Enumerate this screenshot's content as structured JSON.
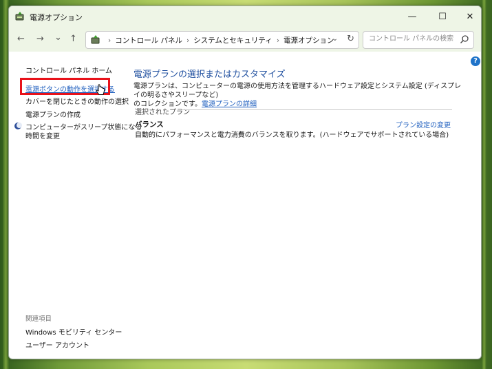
{
  "window": {
    "title": "電源オプション",
    "minimize": "—",
    "maximize": "☐",
    "close": "✕"
  },
  "nav": {
    "back": "←",
    "forward": "→",
    "recent": "⌄",
    "up": "↑",
    "breadcrumbs": [
      "コントロール パネル",
      "システムとセキュリティ",
      "電源オプション"
    ],
    "refresh": "↻",
    "search_placeholder": "コントロール パネルの検索"
  },
  "sidebar": {
    "home": "コントロール パネル ホーム",
    "items": [
      "電源ボタンの動作を選択する",
      "カバーを閉じたときの動作の選択",
      "電源プランの作成",
      "コンピューターがスリープ状態になる",
      "時間を変更"
    ],
    "related_heading": "関連項目",
    "related": [
      "Windows モビリティ センター",
      "ユーザー アカウント"
    ]
  },
  "main": {
    "heading": "電源プランの選択またはカスタマイズ",
    "description_line1": "電源プランは、コンピューターの電源の使用方法を管理するハードウェア設定とシステム設定 (ディスプレイの明るさやスリープなど)",
    "description_line2": "のコレクションです。",
    "description_link": "電源プランの詳細",
    "selected_plan_label": "選択されたプラン",
    "plan_name": "バランス",
    "plan_description": "自動的にパフォーマンスと電力消費のバランスを取ります。(ハードウェアでサポートされている場合)",
    "plan_change_link": "プラン設定の変更"
  },
  "help_glyph": "?",
  "colors": {
    "highlight": "#e8121a",
    "link": "#1f5fbf",
    "heading": "#1f4f9f"
  }
}
